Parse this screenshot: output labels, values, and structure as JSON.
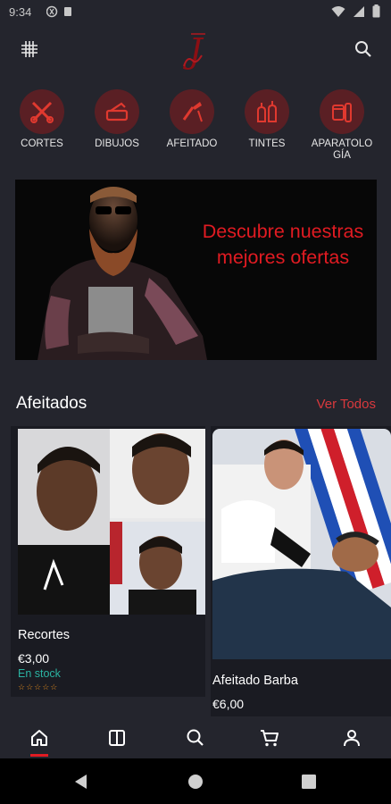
{
  "status_bar": {
    "time": "9:34"
  },
  "header": {
    "logo_alt": "J",
    "menu_icon": "grid-icon",
    "search_icon": "search-icon"
  },
  "categories": [
    {
      "label": "CORTES",
      "icon": "scissors-comb-icon"
    },
    {
      "label": "DIBUJOS",
      "icon": "razor-icon"
    },
    {
      "label": "AFEITADO",
      "icon": "straight-razor-icon"
    },
    {
      "label": "TINTES",
      "icon": "dye-bottles-icon"
    },
    {
      "label": "APARATOLOGÍA",
      "icon": "clipper-icon"
    }
  ],
  "banner": {
    "text": "Descubre nuestras mejores ofertas"
  },
  "section": {
    "title": "Afeitados",
    "see_all": "Ver Todos"
  },
  "products": [
    {
      "name": "Recortes",
      "price": "€3,00",
      "stock": "En stock",
      "stars": "☆☆☆☆☆",
      "rating": 0
    },
    {
      "name": "Afeitado Barba",
      "price": "€6,00"
    }
  ],
  "colors": {
    "accent": "#e11b22",
    "background": "#24252d",
    "stock": "#2bb3a2"
  },
  "bottom_nav": [
    {
      "icon": "home-icon",
      "active": true
    },
    {
      "icon": "catalog-icon"
    },
    {
      "icon": "search-icon"
    },
    {
      "icon": "cart-icon"
    },
    {
      "icon": "profile-icon"
    }
  ]
}
